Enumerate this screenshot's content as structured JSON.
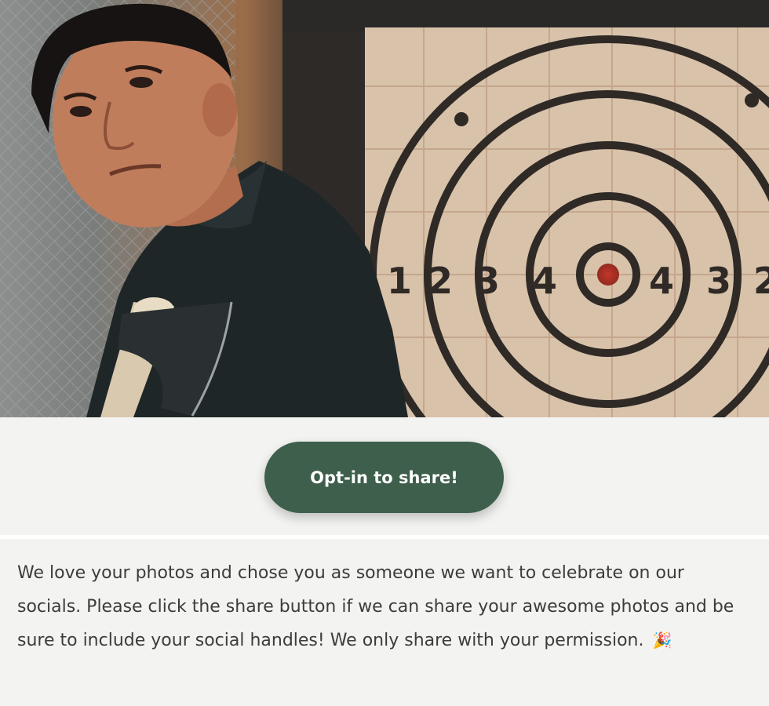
{
  "hero": {
    "image": "man-holding-axe-in-front-of-target",
    "target_numbers": [
      "1",
      "2",
      "3",
      "4",
      "4",
      "3",
      "2"
    ]
  },
  "cta": {
    "button_label": "Opt-in to share!",
    "button_color": "#3d5f4b"
  },
  "message": {
    "text": "We love your photos and chose you as someone we want to celebrate on our socials. Please click the share button if we can share your awesome photos and be sure to include your social handles!  We only share with your permission.",
    "emoji": "🎉",
    "emoji_icon": "party-popper-icon"
  }
}
